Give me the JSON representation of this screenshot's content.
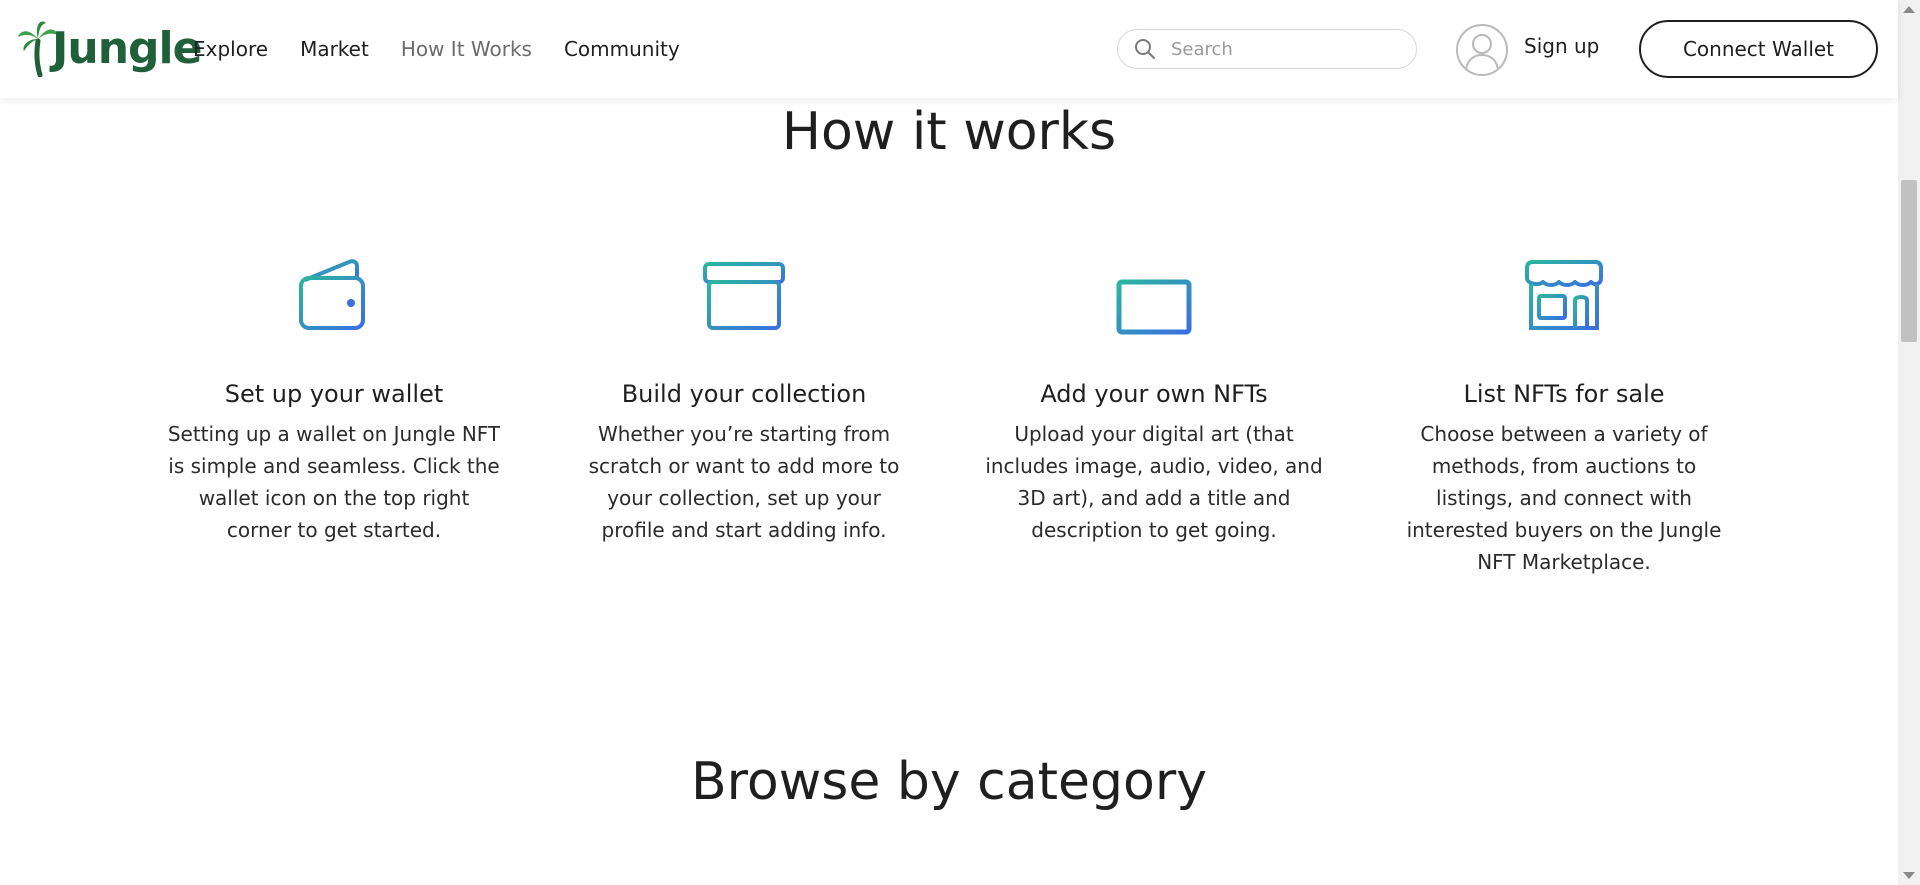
{
  "header": {
    "logo_text": "Jungle",
    "nav": [
      {
        "label": "Explore",
        "active": false
      },
      {
        "label": "Market",
        "active": false
      },
      {
        "label": "How It Works",
        "active": true
      },
      {
        "label": "Community",
        "active": false
      }
    ],
    "search_placeholder": "Search",
    "signup_label": "Sign up",
    "connect_label": "Connect Wallet"
  },
  "how": {
    "title": "How it works",
    "steps": [
      {
        "icon": "wallet-icon",
        "title": "Set up your wallet",
        "desc": "Setting up a wallet on Jungle NFT is simple and seamless. Click the wallet icon on the top right corner to get started."
      },
      {
        "icon": "archive-box-icon",
        "title": "Build your collection",
        "desc": "Whether you’re starting from scratch or want to add more to your collection, set up your profile and start adding info."
      },
      {
        "icon": "add-stack-icon",
        "title": "Add your own NFTs",
        "desc": "Upload your digital art (that includes image, audio, video, and 3D art), and add a title and description to get going."
      },
      {
        "icon": "storefront-icon",
        "title": "List NFTs for sale",
        "desc": "Choose between a variety of methods, from auctions to listings, and connect with interested buyers on the Jungle NFT Marketplace."
      }
    ]
  },
  "browse": {
    "title": "Browse by category"
  },
  "colors": {
    "gradient_start": "#2bb5a0",
    "gradient_end": "#3b6fe0",
    "logo_green": "#1f5f3a"
  }
}
